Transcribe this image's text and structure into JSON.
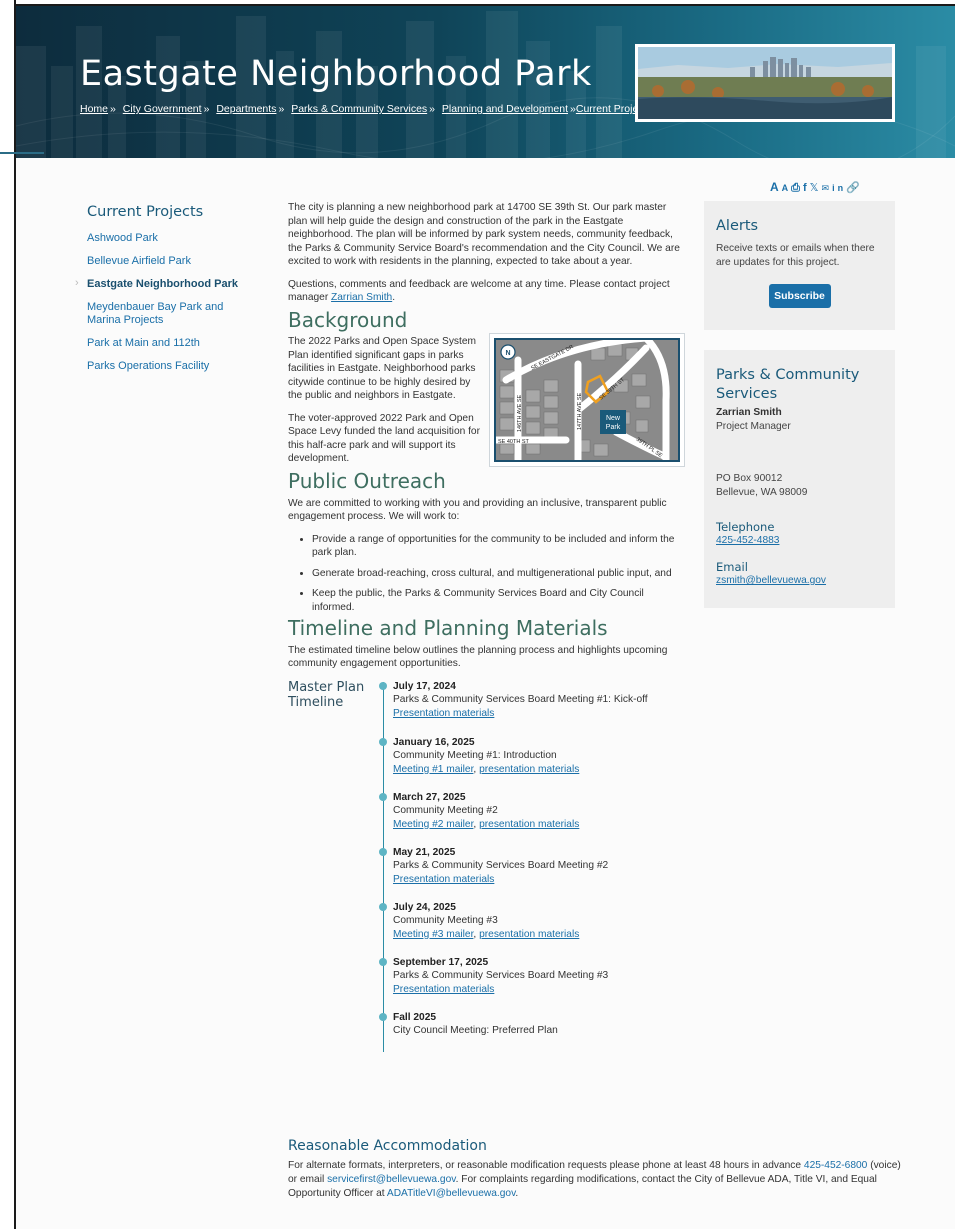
{
  "header": {
    "title": "Eastgate Neighborhood Park",
    "breadcrumb": [
      {
        "label": "Home",
        "sep": "»"
      },
      {
        "label": "City Government",
        "sep": "»"
      },
      {
        "label": "Departments",
        "sep": "»"
      },
      {
        "label": "Parks & Community Services",
        "sep": "»"
      },
      {
        "label": "Planning and Development",
        "sep": "»"
      },
      {
        "label": "Current Projects",
        "sep": ""
      }
    ]
  },
  "share_tools": [
    "text-larger-icon",
    "text-smaller-icon",
    "print-icon",
    "facebook-icon",
    "x-icon",
    "email-icon",
    "linkedin-icon",
    "link-icon"
  ],
  "sidebar": {
    "title": "Current Projects",
    "items": [
      {
        "label": "Ashwood Park"
      },
      {
        "label": "Bellevue Airfield Park"
      },
      {
        "label": "Eastgate Neighborhood Park"
      },
      {
        "label": "Meydenbauer Bay Park and Marina Projects"
      },
      {
        "label": "Park at Main and 112th"
      },
      {
        "label": "Parks Operations Facility"
      }
    ]
  },
  "intro": {
    "p1": "The city is planning a new neighborhood park at 14700 SE 39th St. Our park master plan will help guide the design and construction of the park in the Eastgate neighborhood. The plan will be informed by park system needs, community feedback, the Parks & Community Service Board's recommendation and the City Council. We are excited to work with residents in the planning, expected to take about a year.",
    "p2_before": "Questions, comments and feedback are welcome at any time. Please contact project manager ",
    "p2_link": "Zarrian Smith",
    "p2_after": "."
  },
  "background": {
    "heading": "Background",
    "p1": "The 2022 Parks and Open Space System Plan identified significant gaps in parks facilities in Eastgate. Neighborhood parks citywide continue to be highly desired by the public and neighbors in Eastgate.",
    "p2": "The voter-approved 2022 Park and Open Space Levy funded the land acquisition for this half-acre park and will support its development.",
    "map": {
      "north": "N",
      "streets": [
        "SE EASTGATE DR",
        "146TH AVE SE",
        "147TH AVE SE",
        "SE 39TH ST",
        "SE 40TH ST",
        "39TH PL SE"
      ],
      "park_label_1": "New",
      "park_label_2": "Park"
    }
  },
  "outreach": {
    "heading": "Public Outreach",
    "intro": "We are committed to working with you and providing an inclusive, transparent public engagement process. We will work to:",
    "items": [
      "Provide a range of opportunities for the community to be included and inform the park plan.",
      "Generate broad-reaching, cross cultural, and multigenerational public input, and",
      "Keep the public, the Parks & Community Services Board and City Council informed."
    ]
  },
  "timeline": {
    "heading": "Timeline and Planning Materials",
    "intro": "The estimated timeline below outlines the planning process and highlights upcoming community engagement opportunities.",
    "label": "Master Plan Timeline",
    "events": [
      {
        "date": "July 17, 2024",
        "desc": "Parks & Community Services Board Meeting #1: Kick-off",
        "link1": "Presentation materials",
        "link2": ""
      },
      {
        "date": "January 16, 2025",
        "desc": "Community Meeting #1: Introduction",
        "link1": "Meeting #1 mailer",
        "link2": "presentation materials"
      },
      {
        "date": "March 27, 2025",
        "desc": "Community Meeting #2",
        "link1": "Meeting #2 mailer",
        "link2": "presentation materials"
      },
      {
        "date": "May 21, 2025",
        "desc": "Parks & Community Services Board Meeting #2",
        "link1": "Presentation materials",
        "link2": ""
      },
      {
        "date": "July 24, 2025",
        "desc": "Community Meeting #3",
        "link1": "Meeting #3 mailer",
        "link2": "presentation materials"
      },
      {
        "date": "September 17, 2025",
        "desc": "Parks & Community Services Board Meeting #3",
        "link1": "Presentation materials",
        "link2": ""
      },
      {
        "date": "Fall 2025",
        "desc": "City Council Meeting: Preferred Plan",
        "link1": "",
        "link2": ""
      }
    ]
  },
  "accommodation": {
    "heading": "Reasonable Accommodation",
    "t1": "For alternate formats, interpreters, or reasonable modification requests please phone at least 48 hours in advance ",
    "phone": "425-452-6800",
    "t2": " (voice) or email ",
    "email1": "servicefirst@bellevuewa.gov",
    "t3": ". For complaints regarding modifications, contact the City of Bellevue ADA, Title VI, and Equal Opportunity Officer at ",
    "email2": "ADATitleVI@bellevuewa.gov",
    "t4": "."
  },
  "alerts": {
    "heading": "Alerts",
    "text": "Receive texts or emails when there are updates for this project.",
    "button": "Subscribe"
  },
  "contact": {
    "heading": "Parks & Community Services",
    "name": "Zarrian Smith",
    "role": "Project Manager",
    "address1": "PO Box 90012",
    "address2": "Bellevue, WA 98009",
    "phone_label": "Telephone",
    "phone": "425-452-4883",
    "email_label": "Email",
    "email": "zsmith@bellevuewa.gov"
  },
  "colors": {
    "accent": "#1a6fa8",
    "heading_green": "#3e6e60",
    "timeline_dot": "#5db4c4",
    "hero_dark": "#0d2c3d"
  }
}
